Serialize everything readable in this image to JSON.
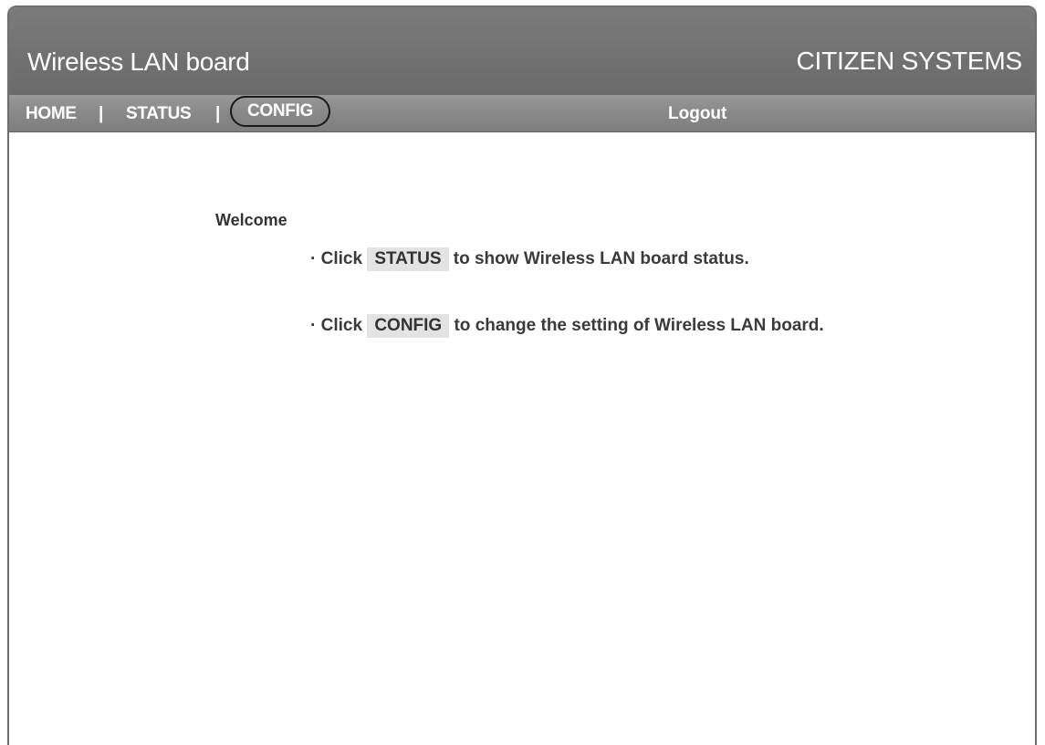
{
  "header": {
    "app_title": "Wireless LAN board",
    "brand": "CITIZEN SYSTEMS"
  },
  "nav": {
    "home": "HOME",
    "status": "STATUS",
    "config": "CONFIG",
    "separator": "|",
    "logout": "Logout",
    "highlighted_item": "CONFIG"
  },
  "content": {
    "welcome": "Welcome",
    "bullet": "·",
    "line1": {
      "prefix": "Click",
      "chip": "STATUS",
      "suffix": "to show Wireless LAN board status."
    },
    "line2": {
      "prefix": "Click",
      "chip": "CONFIG",
      "suffix": "to change the setting of Wireless LAN board."
    }
  },
  "colors": {
    "header_bg": "#6f6f6f",
    "navbar_bg": "#8a8a8a",
    "highlight_ring": "#1a1a1a",
    "chip_bg": "#e3e3e3"
  }
}
